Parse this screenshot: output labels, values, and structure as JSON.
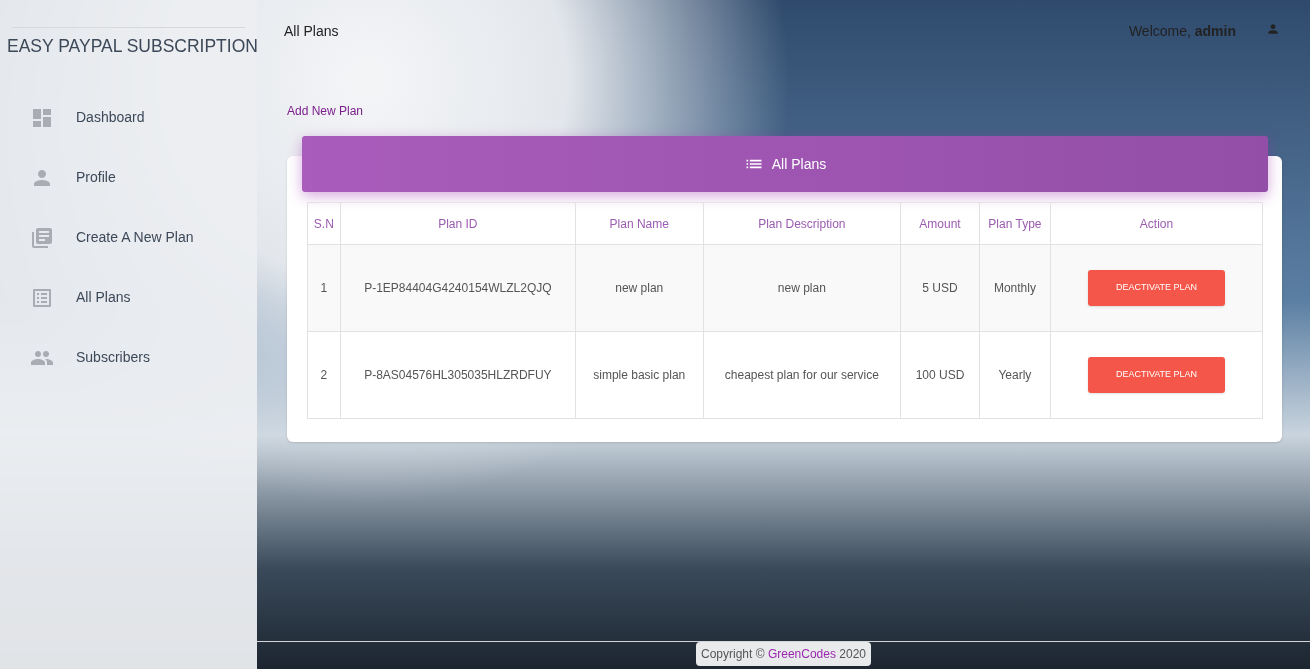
{
  "sidebar": {
    "brand": "EASY PAYPAL SUBSCRIPTION",
    "items": [
      {
        "kind": "dashboard",
        "label": "Dashboard",
        "selected": false
      },
      {
        "kind": "profile",
        "label": "Profile",
        "selected": false
      },
      {
        "kind": "create",
        "label": "Create A New Plan",
        "selected": false
      },
      {
        "kind": "plans",
        "label": "All Plans",
        "selected": false
      },
      {
        "kind": "subscribers",
        "label": "Subscribers",
        "selected": false
      }
    ]
  },
  "header": {
    "title": "All Plans",
    "welcome": "Welcome, **admin**"
  },
  "add_link": "Add New Plan",
  "card": {
    "title": "All Plans",
    "table": {
      "columns": [
        "S.N",
        "Plan ID",
        "Plan Name",
        "Plan Description",
        "Amount",
        "Plan Type",
        "Action"
      ],
      "rows": [
        {
          "cells": [
            "1",
            "P-1EP84404G4240154WLZL2QJQ",
            "new plan",
            "new plan",
            "5 USD",
            "Monthly"
          ],
          "action": "DEACTIVATE PLAN"
        },
        {
          "cells": [
            "2",
            "P-8AS04576HL305035HLZRDFUY",
            "simple basic plan",
            "cheapest plan for our service",
            "100 USD",
            "Yearly"
          ],
          "action": "DEACTIVATE PLAN"
        }
      ]
    }
  },
  "footer": {
    "prefix": "Copyright ©",
    "link": "GreenCodes",
    "suffix": "2020"
  }
}
